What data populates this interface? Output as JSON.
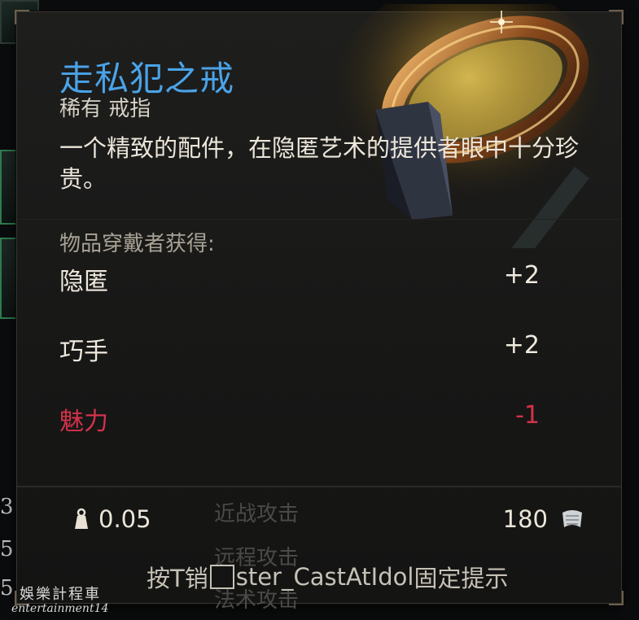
{
  "item": {
    "name": "走私犯之戒",
    "type": "稀有 戒指",
    "description": "一个精致的配件，在隐匿艺术的提供者眼中十分珍贵。"
  },
  "grants": {
    "title": "物品穿戴者获得:",
    "stats": [
      {
        "label": "隐匿",
        "value": "+2"
      },
      {
        "label": "巧手",
        "value": "+2"
      },
      {
        "label": "魅力",
        "value": "-1"
      }
    ]
  },
  "footer": {
    "weight": "0.05",
    "price": "180",
    "weight_icon": "weight-icon",
    "price_icon": "gold-coin-icon"
  },
  "hint": {
    "prefix": "按T销",
    "middle": "ster_CastAtIdol",
    "suffix": "固定提示"
  },
  "background": {
    "menu_items": [
      "近战攻击",
      "远程攻击",
      "法术攻击"
    ],
    "hotbar_numbers": [
      "3",
      "5",
      "5"
    ]
  },
  "watermark": {
    "line1": "娛樂計程車",
    "line2": "entertainment14"
  },
  "colors": {
    "item_name": "#4aa3e8",
    "negative_stat": "#d3324a",
    "panel": "#1a1a19"
  }
}
